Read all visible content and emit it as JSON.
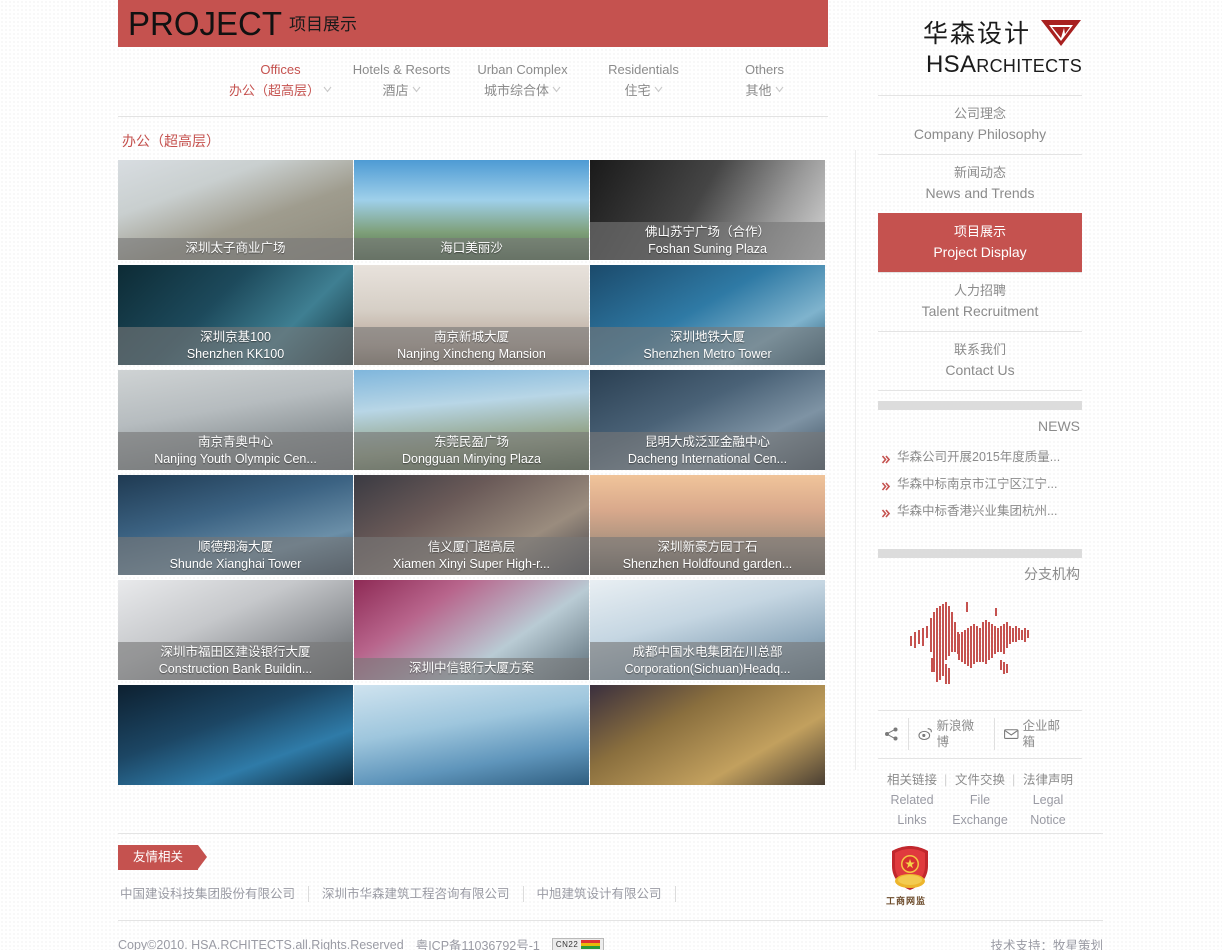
{
  "banner": {
    "en": "PROJECT",
    "cn": "项目展示"
  },
  "categories": [
    {
      "en": "Offices",
      "cn": "办公（超高层）",
      "active": true
    },
    {
      "en": "Hotels & Resorts",
      "cn": "酒店",
      "active": false
    },
    {
      "en": "Urban Complex",
      "cn": "城市综合体",
      "active": false
    },
    {
      "en": "Residentials",
      "cn": "住宅",
      "active": false
    },
    {
      "en": "Others",
      "cn": "其他",
      "active": false
    }
  ],
  "section_title": "办公（超高层）",
  "projects": [
    {
      "cn": "深圳太子商业广场",
      "en": "",
      "g": "linear-gradient(160deg,#d8dde1 0%,#c9cfcf 30%,#9f9c8e 60%,#8d8a7c 100%)"
    },
    {
      "cn": "海口美丽沙",
      "en": "",
      "g": "linear-gradient(180deg,#4e9bd4 0%,#9fd0ea 40%,#7fa07a 72%,#4e6b4a 100%)"
    },
    {
      "cn": "佛山苏宁广场（合作）",
      "en": "Foshan Suning Plaza",
      "g": "linear-gradient(120deg,#1a1a1a 0%,#454545 45%,#9a9a9a 75%,#d6d6d6 100%)"
    },
    {
      "cn": "深圳京基100",
      "en": "Shenzhen KK100",
      "g": "linear-gradient(135deg,#0d2b35 0%,#1d4a5c 40%,#3f7f92 70%,#12303a 100%)"
    },
    {
      "cn": "南京新城大厦",
      "en": "Nanjing Xincheng Mansion",
      "g": "linear-gradient(180deg,#e8e2dc 0%,#d6cfc6 45%,#b9a79a 80%,#8e7e6f 100%)"
    },
    {
      "cn": "深圳地铁大厦",
      "en": "Shenzhen Metro Tower",
      "g": "linear-gradient(150deg,#1b4a6b 0%,#2f7aa5 45%,#7fb3cd 75%,#24536e 100%)"
    },
    {
      "cn": "南京青奥中心",
      "en": "Nanjing Youth Olympic Cen...",
      "g": "linear-gradient(170deg,#cfd3d4 0%,#b6bcbf 40%,#8f9699 70%,#6f7679 100%)"
    },
    {
      "cn": "东莞民盈广场",
      "en": "Dongguan Minying Plaza",
      "g": "linear-gradient(175deg,#7fb6dc 0%,#b8d6e6 35%,#8f9f80 72%,#4e6243 100%)"
    },
    {
      "cn": "昆明大成泛亚金融中心",
      "en": "Dacheng International Cen...",
      "g": "linear-gradient(155deg,#2a3f52 0%,#4a6277 40%,#7e93a4 70%,#3b4d5d 100%)"
    },
    {
      "cn": "顺德翔海大厦",
      "en": "Shunde Xianghai Tower",
      "g": "linear-gradient(165deg,#1f3a52 0%,#3c6383 40%,#6b8fa8 72%,#2b4155 100%)"
    },
    {
      "cn": "信义厦门超高层",
      "en": "Xiamen Xinyi Super High-r...",
      "g": "linear-gradient(150deg,#3a3a42 0%,#6a5a58 35%,#9a8c7e 70%,#43434a 100%)"
    },
    {
      "cn": "深圳新豪方园丁石",
      "en": "Shenzhen Holdfound garden...",
      "g": "linear-gradient(180deg,#f0c49a 0%,#d9a98c 35%,#a8917e 70%,#6e6258 100%)"
    },
    {
      "cn": "深圳市福田区建设银行大厦",
      "en": "Construction Bank Buildin...",
      "g": "linear-gradient(155deg,#e9eaec 0%,#c6c8cb 40%,#8e9195 72%,#5c6063 100%)"
    },
    {
      "cn": "深圳中信银行大厦方案",
      "en": "",
      "g": "linear-gradient(145deg,#8e2a55 0%,#b8658c 30%,#b9cbd4 65%,#5d6f7a 100%)"
    },
    {
      "cn": "成都中国水电集团在川总部",
      "en": "Corporation(Sichuan)Headq...",
      "g": "linear-gradient(165deg,#e9eff3 0%,#c5d6e2 40%,#90aabd 72%,#5e7889 100%)"
    },
    {
      "cn": "",
      "en": "",
      "g": "linear-gradient(160deg,#0d2030 0%,#1c4664 40%,#2f7ba8 70%,#0f2a3c 100%)"
    },
    {
      "cn": "",
      "en": "",
      "g": "linear-gradient(170deg,#cfe3ef 0%,#9ec6dd 40%,#5f95bb 72%,#2f5e80 100%)"
    },
    {
      "cn": "",
      "en": "",
      "g": "linear-gradient(150deg,#3a2f3e 0%,#8a6f3e 35%,#c2a05e 70%,#4a3f33 100%)"
    }
  ],
  "friendly": {
    "tag": "友情相关",
    "partners": [
      "中国建设科技集团股份有限公司",
      "深圳市华森建筑工程咨询有限公司",
      "中旭建筑设计有限公司"
    ]
  },
  "copyright": {
    "text": "Copy©2010. HSA.RCHITECTS.all.Rights.Reserved",
    "icp": "粤ICP备11036792号-1",
    "badge": "CN22",
    "support": "技术支持：牧星策划"
  },
  "sidebar": {
    "logo": {
      "cn": "华森设计",
      "en_big": "HSA",
      "en_small": "RCHITECTS"
    },
    "nav": [
      {
        "cn": "公司理念",
        "en": "Company Philosophy",
        "active": false
      },
      {
        "cn": "新闻动态",
        "en": "News and Trends",
        "active": false
      },
      {
        "cn": "项目展示",
        "en": "Project Display",
        "active": true
      },
      {
        "cn": "人力招聘",
        "en": "Talent Recruitment",
        "active": false
      },
      {
        "cn": "联系我们",
        "en": "Contact Us",
        "active": false
      }
    ],
    "news_title": "NEWS",
    "news": [
      "华森公司开展2015年度质量...",
      "华森中标南京市江宁区江宁...",
      "华森中标香港兴业集团杭州..."
    ],
    "branch_title": "分支机构",
    "social": [
      {
        "icon": "share-icon",
        "label": ""
      },
      {
        "icon": "weibo-icon",
        "label": "新浪微博"
      },
      {
        "icon": "mail-icon",
        "label": "企业邮箱"
      }
    ],
    "links3": [
      {
        "cn": "相关链接",
        "en": "Related Links"
      },
      {
        "cn": "文件交换",
        "en": "File Exchange"
      },
      {
        "cn": "法律声明",
        "en": "Legal Notice"
      }
    ],
    "gov_badge_caption": "工商网监"
  },
  "colors": {
    "accent": "#c5524f",
    "text_gray": "#8b8b8b",
    "rule": "#e4e4e4"
  }
}
